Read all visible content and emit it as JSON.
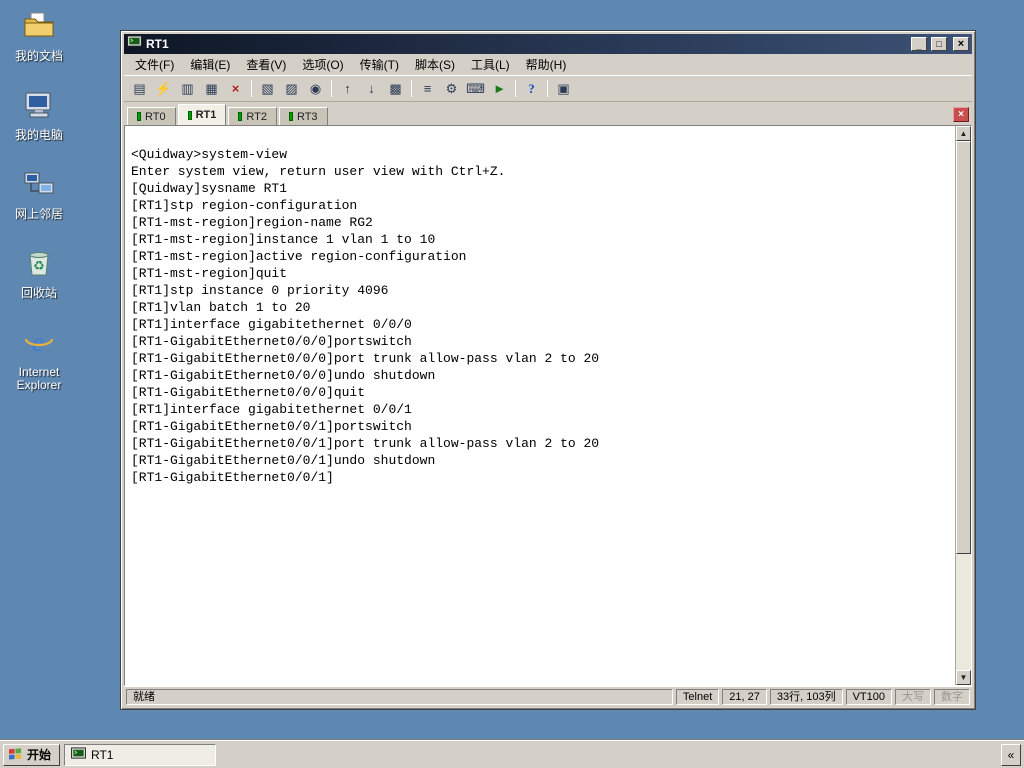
{
  "colors": {
    "desktop_bg": "#5E87B2",
    "chrome": "#D4D0C8",
    "titlebar_left": "#0E1626",
    "titlebar_right": "#3D5277",
    "tab_indicator_green": "#00A000",
    "tab_close_red": "#C94F4F",
    "terminal_bg": "#FFFFFF",
    "terminal_fg": "#000000"
  },
  "desktop": {
    "icons": [
      {
        "name": "my-documents",
        "label": "我的文档"
      },
      {
        "name": "my-computer",
        "label": "我的电脑"
      },
      {
        "name": "network-places",
        "label": "网上邻居"
      },
      {
        "name": "recycle-bin",
        "label": "回收站"
      },
      {
        "name": "internet-explorer",
        "label": "Internet Explorer"
      }
    ]
  },
  "window": {
    "title": "RT1",
    "controls": {
      "minimize": "_",
      "maximize": "□",
      "close": "×"
    },
    "menu": [
      "文件(F)",
      "编辑(E)",
      "查看(V)",
      "选项(O)",
      "传输(T)",
      "脚本(S)",
      "工具(L)",
      "帮助(H)"
    ],
    "toolbar": [
      {
        "name": "session-manager-icon",
        "glyph": "▤"
      },
      {
        "name": "quick-connect-icon",
        "glyph": "⚡"
      },
      {
        "name": "clone-session-icon",
        "glyph": "▥"
      },
      {
        "name": "connect-icon",
        "glyph": "▦"
      },
      {
        "name": "disconnect-icon",
        "glyph": "×"
      },
      {
        "name": "copy-icon",
        "glyph": "▧"
      },
      {
        "name": "paste-icon",
        "glyph": "▨"
      },
      {
        "name": "find-icon",
        "glyph": "◉"
      },
      {
        "name": "upload-icon",
        "glyph": "↑"
      },
      {
        "name": "download-icon",
        "glyph": "↓"
      },
      {
        "name": "print-icon",
        "glyph": "▩"
      },
      {
        "name": "properties-icon",
        "glyph": "≡"
      },
      {
        "name": "session-options-icon",
        "glyph": "⚙"
      },
      {
        "name": "keymap-icon",
        "glyph": "⌨"
      },
      {
        "name": "run-script-icon",
        "glyph": "►"
      },
      {
        "name": "help-icon",
        "glyph": "?"
      },
      {
        "name": "tile-windows-icon",
        "glyph": "▣"
      }
    ],
    "tabs": [
      {
        "label": "RT0",
        "active": false
      },
      {
        "label": "RT1",
        "active": true
      },
      {
        "label": "RT2",
        "active": false
      },
      {
        "label": "RT3",
        "active": false
      }
    ],
    "tab_close": "×",
    "scrollbar": {
      "up": "▲",
      "down": "▼"
    },
    "terminal": {
      "lines": [
        "",
        "<Quidway>system-view",
        "Enter system view, return user view with Ctrl+Z.",
        "[Quidway]sysname RT1",
        "[RT1]stp region-configuration",
        "[RT1-mst-region]region-name RG2",
        "[RT1-mst-region]instance 1 vlan 1 to 10",
        "[RT1-mst-region]active region-configuration",
        "[RT1-mst-region]quit",
        "[RT1]stp instance 0 priority 4096",
        "[RT1]vlan batch 1 to 20",
        "[RT1]interface gigabitethernet 0/0/0",
        "[RT1-GigabitEthernet0/0/0]portswitch",
        "[RT1-GigabitEthernet0/0/0]port trunk allow-pass vlan 2 to 20",
        "[RT1-GigabitEthernet0/0/0]undo shutdown",
        "[RT1-GigabitEthernet0/0/0]quit",
        "[RT1]interface gigabitethernet 0/0/1",
        "[RT1-GigabitEthernet0/0/1]portswitch",
        "[RT1-GigabitEthernet0/0/1]port trunk allow-pass vlan 2 to 20",
        "[RT1-GigabitEthernet0/0/1]undo shutdown",
        "[RT1-GigabitEthernet0/0/1]"
      ]
    },
    "status": {
      "ready": "就绪",
      "protocol": "Telnet",
      "cursor": "21, 27",
      "size": "33行, 103列",
      "emulation": "VT100",
      "caps": "大写",
      "num": "数字"
    }
  },
  "taskbar": {
    "start_label": "开始",
    "task_label": "RT1",
    "tray_chevron": "«"
  }
}
